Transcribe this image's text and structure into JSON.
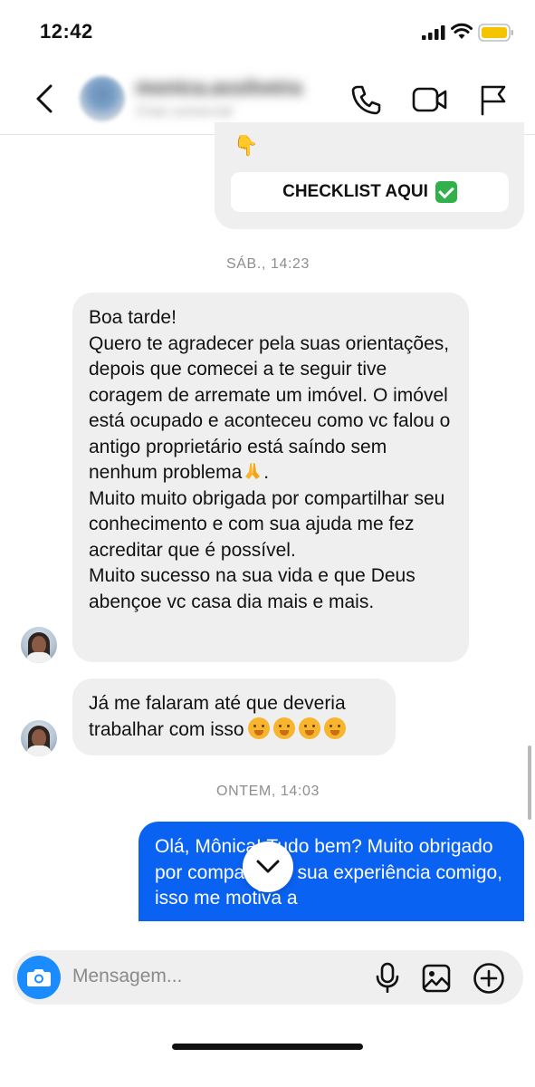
{
  "status_bar": {
    "time": "12:42"
  },
  "header": {
    "contact_name": "monica.assilveira",
    "contact_subtitle": "Chat comercial",
    "icons": [
      "back-icon",
      "phone-icon",
      "video-icon",
      "flag-icon"
    ]
  },
  "previous_message": {
    "emoji": "👇",
    "button_label": "CHECKLIST AQUI"
  },
  "timestamps": {
    "sat": "SÁB., 14:23",
    "yesterday": "ONTEM, 14:03"
  },
  "incoming_message_1": {
    "lines": [
      "Boa tarde!",
      "Quero te agradecer pela suas orientações, depois que comecei a te seguir tive coragem de arremate um imóvel. O imóvel está ocupado e aconteceu como vc falou o antigo proprietário está saíndo sem nenhum problema",
      ".",
      "Muito muito obrigada por compartilhar seu conhecimento e com sua ajuda me fez acreditar que é possível.",
      "Muito sucesso na sua vida e que Deus abençoe vc casa dia mais e mais."
    ]
  },
  "incoming_message_2": {
    "text": "Já me falaram até que deveria trabalhar com isso"
  },
  "outgoing_message": {
    "text": "Olá, Mônica! Tudo bem? Muito obrigado por compartilhar sua experiência comigo, isso me motiva a"
  },
  "composer": {
    "placeholder": "Mensagem...",
    "icons": [
      "camera-icon",
      "microphone-icon",
      "image-icon",
      "plus-icon"
    ]
  },
  "colors": {
    "outgoing_bubble": "#0a62f3",
    "incoming_bubble": "#efefef",
    "camera_button": "#1a8cff",
    "battery": "#f5c400"
  }
}
